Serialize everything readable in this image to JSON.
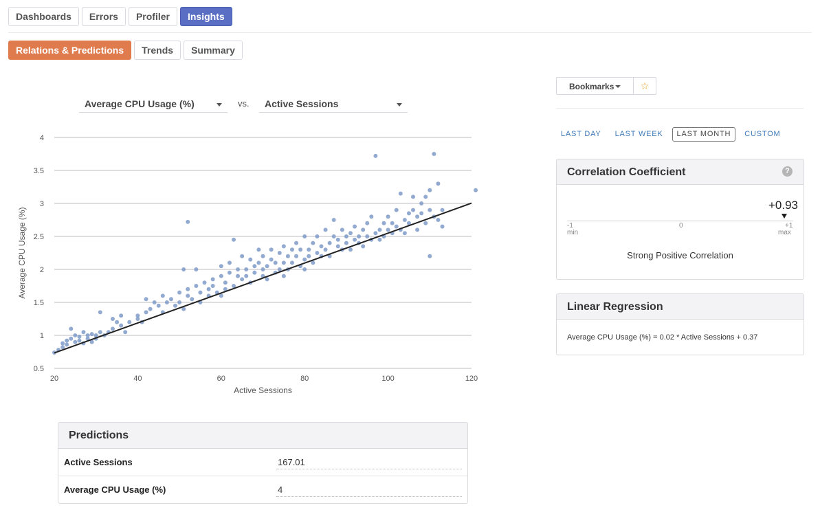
{
  "nav": {
    "tabs": [
      {
        "label": "Dashboards",
        "active": false
      },
      {
        "label": "Errors",
        "active": false
      },
      {
        "label": "Profiler",
        "active": false
      },
      {
        "label": "Insights",
        "active": true
      }
    ],
    "subtabs": [
      {
        "label": "Relations & Predictions",
        "active": true
      },
      {
        "label": "Trends",
        "active": false
      },
      {
        "label": "Summary",
        "active": false
      }
    ]
  },
  "selectors": {
    "y_metric": "Average CPU Usage (%)",
    "vs": "vs.",
    "x_metric": "Active Sessions"
  },
  "toolbar": {
    "bookmarks_label": "Bookmarks",
    "star_icon": "star-icon",
    "ranges": [
      {
        "label": "LAST DAY",
        "active": false
      },
      {
        "label": "LAST WEEK",
        "active": false
      },
      {
        "label": "LAST MONTH",
        "active": true
      },
      {
        "label": "CUSTOM",
        "active": false
      }
    ]
  },
  "correlation": {
    "title": "Correlation Coefficient",
    "help_icon": "help-icon",
    "value_label": "+0.93",
    "value": 0.93,
    "min_tick": "-1",
    "min_label": "min",
    "mid_tick": "0",
    "max_tick": "+1",
    "max_label": "max",
    "description": "Strong Positive Correlation"
  },
  "regression": {
    "title": "Linear Regression",
    "equation": "Average CPU Usage (%) = 0.02 * Active Sessions + 0.37"
  },
  "predictions": {
    "title": "Predictions",
    "rows": [
      {
        "label": "Active Sessions",
        "value": "167.01"
      },
      {
        "label": "Average CPU Usage (%)",
        "value": "4"
      }
    ]
  },
  "chart_data": {
    "type": "scatter",
    "xlabel": "Active Sessions",
    "ylabel": "Average CPU Usage (%)",
    "xlim": [
      20,
      120
    ],
    "ylim": [
      0.5,
      4
    ],
    "x_ticks": [
      "20",
      "40",
      "60",
      "80",
      "100",
      "120"
    ],
    "y_ticks": [
      "0.5",
      "1",
      "1.5",
      "2",
      "2.5",
      "3",
      "3.5",
      "4"
    ],
    "grid": "horizontal",
    "point_color": "#7f9bc8",
    "trendline": {
      "slope": 0.0227,
      "intercept": 0.28
    },
    "points": [
      [
        20,
        0.74
      ],
      [
        21,
        0.78
      ],
      [
        22,
        0.82
      ],
      [
        22,
        0.88
      ],
      [
        23,
        0.86
      ],
      [
        23,
        0.92
      ],
      [
        24,
        0.95
      ],
      [
        24,
        1.1
      ],
      [
        25,
        0.9
      ],
      [
        25,
        1.0
      ],
      [
        26,
        0.92
      ],
      [
        26,
        0.98
      ],
      [
        27,
        0.88
      ],
      [
        27,
        1.05
      ],
      [
        28,
        0.95
      ],
      [
        28,
        1.0
      ],
      [
        29,
        0.9
      ],
      [
        29,
        1.02
      ],
      [
        30,
        1.0
      ],
      [
        30,
        0.95
      ],
      [
        31,
        1.05
      ],
      [
        31,
        1.35
      ],
      [
        32,
        1.0
      ],
      [
        33,
        1.05
      ],
      [
        34,
        1.1
      ],
      [
        34,
        1.25
      ],
      [
        35,
        1.2
      ],
      [
        36,
        1.3
      ],
      [
        36,
        1.15
      ],
      [
        37,
        1.05
      ],
      [
        38,
        1.2
      ],
      [
        40,
        1.3
      ],
      [
        40,
        1.25
      ],
      [
        41,
        1.2
      ],
      [
        42,
        1.35
      ],
      [
        42,
        1.55
      ],
      [
        43,
        1.4
      ],
      [
        44,
        1.5
      ],
      [
        45,
        1.45
      ],
      [
        46,
        1.35
      ],
      [
        46,
        1.6
      ],
      [
        47,
        1.5
      ],
      [
        48,
        1.55
      ],
      [
        49,
        1.45
      ],
      [
        50,
        1.5
      ],
      [
        50,
        1.65
      ],
      [
        51,
        1.4
      ],
      [
        51,
        2.0
      ],
      [
        52,
        1.6
      ],
      [
        52,
        1.7
      ],
      [
        52,
        2.72
      ],
      [
        53,
        1.55
      ],
      [
        54,
        1.75
      ],
      [
        54,
        2.0
      ],
      [
        55,
        1.65
      ],
      [
        55,
        1.5
      ],
      [
        56,
        1.8
      ],
      [
        57,
        1.7
      ],
      [
        57,
        1.6
      ],
      [
        58,
        1.85
      ],
      [
        58,
        1.75
      ],
      [
        59,
        1.65
      ],
      [
        60,
        1.9
      ],
      [
        60,
        1.6
      ],
      [
        60,
        2.05
      ],
      [
        61,
        1.8
      ],
      [
        61,
        1.7
      ],
      [
        62,
        1.95
      ],
      [
        62,
        2.1
      ],
      [
        63,
        1.75
      ],
      [
        63,
        2.45
      ],
      [
        64,
        1.9
      ],
      [
        64,
        2.0
      ],
      [
        65,
        1.85
      ],
      [
        65,
        2.2
      ],
      [
        66,
        2.0
      ],
      [
        66,
        1.9
      ],
      [
        67,
        2.15
      ],
      [
        67,
        1.8
      ],
      [
        68,
        2.05
      ],
      [
        68,
        1.95
      ],
      [
        69,
        2.1
      ],
      [
        69,
        2.3
      ],
      [
        70,
        1.9
      ],
      [
        70,
        2.0
      ],
      [
        70,
        2.2
      ],
      [
        71,
        2.05
      ],
      [
        71,
        1.85
      ],
      [
        72,
        2.15
      ],
      [
        72,
        2.3
      ],
      [
        73,
        1.95
      ],
      [
        73,
        2.1
      ],
      [
        74,
        2.25
      ],
      [
        74,
        2.0
      ],
      [
        75,
        2.1
      ],
      [
        75,
        2.35
      ],
      [
        75,
        1.9
      ],
      [
        76,
        2.2
      ],
      [
        76,
        2.0
      ],
      [
        77,
        2.3
      ],
      [
        77,
        2.1
      ],
      [
        78,
        2.4
      ],
      [
        78,
        2.2
      ],
      [
        79,
        2.05
      ],
      [
        79,
        2.3
      ],
      [
        80,
        2.15
      ],
      [
        80,
        2.5
      ],
      [
        80,
        2.0
      ],
      [
        81,
        2.3
      ],
      [
        81,
        2.2
      ],
      [
        82,
        2.4
      ],
      [
        82,
        2.1
      ],
      [
        83,
        2.5
      ],
      [
        83,
        2.25
      ],
      [
        84,
        2.35
      ],
      [
        84,
        2.2
      ],
      [
        85,
        2.6
      ],
      [
        85,
        2.3
      ],
      [
        86,
        2.4
      ],
      [
        86,
        2.2
      ],
      [
        87,
        2.5
      ],
      [
        87,
        2.75
      ],
      [
        88,
        2.35
      ],
      [
        88,
        2.45
      ],
      [
        89,
        2.3
      ],
      [
        89,
        2.6
      ],
      [
        90,
        2.5
      ],
      [
        90,
        2.4
      ],
      [
        91,
        2.55
      ],
      [
        91,
        2.3
      ],
      [
        92,
        2.45
      ],
      [
        92,
        2.65
      ],
      [
        93,
        2.5
      ],
      [
        93,
        2.4
      ],
      [
        94,
        2.6
      ],
      [
        94,
        2.35
      ],
      [
        95,
        2.7
      ],
      [
        95,
        2.5
      ],
      [
        96,
        2.45
      ],
      [
        96,
        2.8
      ],
      [
        97,
        2.55
      ],
      [
        97,
        3.72
      ],
      [
        98,
        2.6
      ],
      [
        98,
        2.45
      ],
      [
        99,
        2.7
      ],
      [
        99,
        2.5
      ],
      [
        100,
        2.6
      ],
      [
        100,
        2.8
      ],
      [
        101,
        2.55
      ],
      [
        101,
        2.7
      ],
      [
        102,
        2.65
      ],
      [
        102,
        2.9
      ],
      [
        103,
        2.6
      ],
      [
        103,
        3.15
      ],
      [
        104,
        2.75
      ],
      [
        104,
        2.55
      ],
      [
        105,
        2.85
      ],
      [
        105,
        2.7
      ],
      [
        106,
        2.9
      ],
      [
        106,
        3.1
      ],
      [
        107,
        2.8
      ],
      [
        107,
        2.6
      ],
      [
        108,
        3.0
      ],
      [
        108,
        2.85
      ],
      [
        109,
        3.1
      ],
      [
        109,
        2.7
      ],
      [
        110,
        2.9
      ],
      [
        110,
        3.2
      ],
      [
        110,
        2.2
      ],
      [
        111,
        3.75
      ],
      [
        111,
        2.8
      ],
      [
        112,
        3.3
      ],
      [
        112,
        2.75
      ],
      [
        113,
        2.9
      ],
      [
        113,
        2.65
      ],
      [
        121,
        3.2
      ]
    ]
  }
}
